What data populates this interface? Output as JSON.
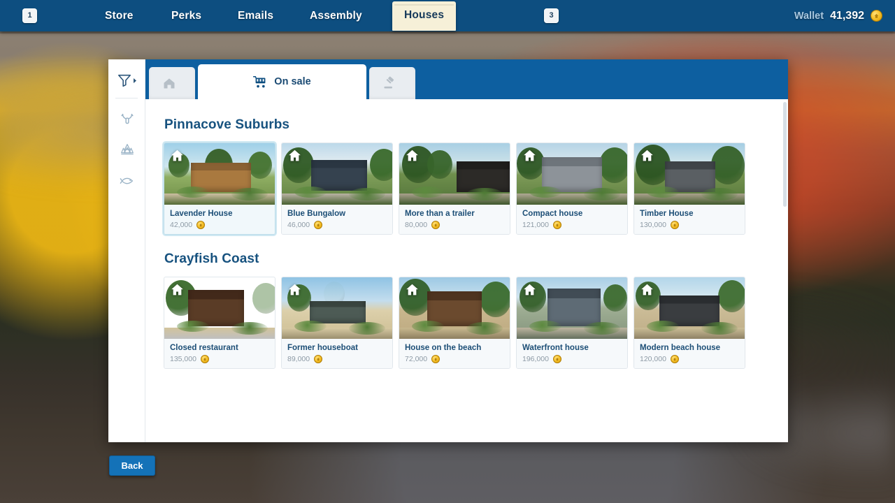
{
  "topbar": {
    "left_badge": "1",
    "right_badge": "3",
    "nav": [
      {
        "label": "Store",
        "active": false
      },
      {
        "label": "Perks",
        "active": false
      },
      {
        "label": "Emails",
        "active": false
      },
      {
        "label": "Assembly",
        "active": false
      },
      {
        "label": "Houses",
        "active": true
      }
    ],
    "wallet_label": "Wallet",
    "wallet_value": "41,392",
    "wallet_currency_icon": "coin-icon"
  },
  "rail": {
    "filter_icon": "filter-icon",
    "filter_expand_icon": "chevron-right-icon",
    "filters": [
      {
        "icon": "antlers-icon",
        "name": "filter-suburbs"
      },
      {
        "icon": "trees-icon",
        "name": "filter-forest"
      },
      {
        "icon": "fish-icon",
        "name": "filter-coast"
      }
    ]
  },
  "tabs": [
    {
      "label": "",
      "icon": "house-icon",
      "active": false,
      "name": "tab-owned"
    },
    {
      "label": "On sale",
      "icon": "shopping-cart-icon",
      "active": true,
      "name": "tab-on-sale"
    },
    {
      "label": "",
      "icon": "gavel-icon",
      "active": false,
      "name": "tab-auction"
    }
  ],
  "sections": [
    {
      "title": "Pinnacove Suburbs",
      "cards": [
        {
          "name": "Lavender House",
          "price": "42,000",
          "selected": true
        },
        {
          "name": "Blue Bungalow",
          "price": "46,000",
          "selected": false
        },
        {
          "name": "More than a trailer",
          "price": "80,000",
          "selected": false
        },
        {
          "name": "Compact house",
          "price": "121,000",
          "selected": false
        },
        {
          "name": "Timber House",
          "price": "130,000",
          "selected": false
        }
      ]
    },
    {
      "title": "Crayfish Coast",
      "cards": [
        {
          "name": "Closed restaurant",
          "price": "135,000",
          "selected": false
        },
        {
          "name": "Former houseboat",
          "price": "89,000",
          "selected": false
        },
        {
          "name": "House on the beach",
          "price": "72,000",
          "selected": false
        },
        {
          "name": "Waterfront house",
          "price": "196,000",
          "selected": false
        },
        {
          "name": "Modern beach house",
          "price": "120,000",
          "selected": false
        }
      ]
    }
  ],
  "back_button": "Back",
  "colors": {
    "topbar_blue": "#0d4e80",
    "tabbar_blue": "#0d5fa0",
    "active_tab_paper": "#f6f0d8",
    "heading_blue": "#17527f",
    "button_blue": "#1472b8",
    "coin_gold": "#f6c12a"
  }
}
